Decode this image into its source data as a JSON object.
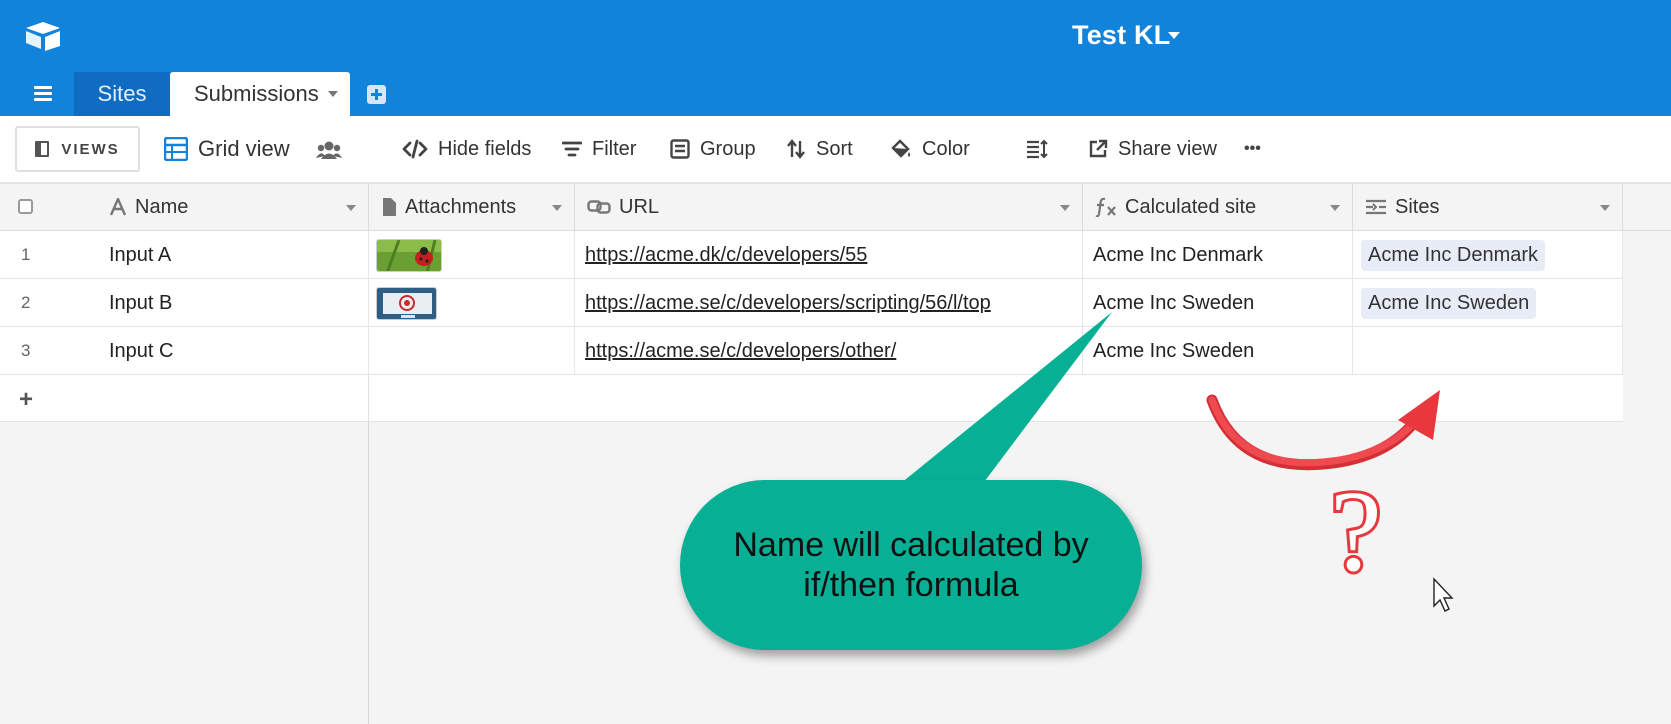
{
  "header": {
    "base_name": "Test KL"
  },
  "tabs": [
    {
      "label": "Sites"
    },
    {
      "label": "Submissions"
    }
  ],
  "toolbar": {
    "views_label": "VIEWS",
    "view_name": "Grid view",
    "hide_fields": "Hide fields",
    "filter": "Filter",
    "group": "Group",
    "sort": "Sort",
    "color": "Color",
    "share_view": "Share view",
    "more": "•••"
  },
  "columns": [
    {
      "label": "Name"
    },
    {
      "label": "Attachments"
    },
    {
      "label": "URL"
    },
    {
      "label": "Calculated site"
    },
    {
      "label": "Sites"
    }
  ],
  "rows": [
    {
      "num": "1",
      "name": "Input A",
      "url": "https://acme.dk/c/developers/55",
      "calculated_site": "Acme Inc Denmark",
      "site": "Acme Inc Denmark"
    },
    {
      "num": "2",
      "name": "Input B",
      "url": "https://acme.se/c/developers/scripting/56/l/top",
      "calculated_site": "Acme Inc Sweden",
      "site": "Acme Inc Sweden"
    },
    {
      "num": "3",
      "name": "Input C",
      "url": "https://acme.se/c/developers/other/",
      "calculated_site": "Acme Inc Sweden",
      "site": ""
    }
  ],
  "add_row": "+",
  "annotation": {
    "callout_text": "Name will calculated by if/then formula",
    "question_mark": "?",
    "colors": {
      "callout": "#07b094",
      "arrow": "#e8383d"
    }
  },
  "colors": {
    "brand": "#1283da"
  }
}
